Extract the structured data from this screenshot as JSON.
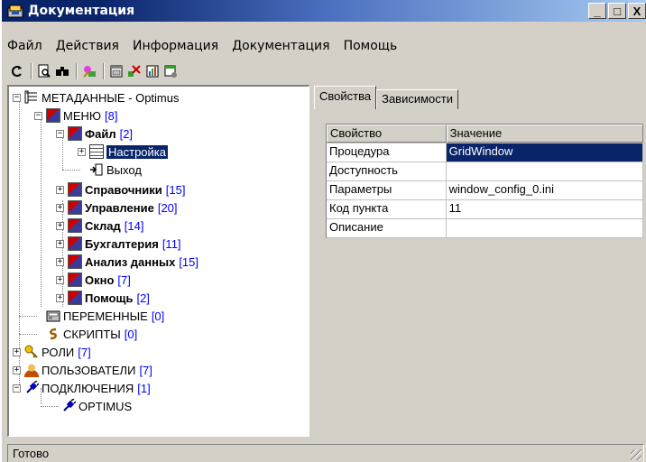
{
  "window": {
    "title": "Документация",
    "minimize": "_",
    "maximize": "□",
    "close": "X"
  },
  "menubar": {
    "items": [
      "Файл",
      "Действия",
      "Информация",
      "Документация",
      "Помощь"
    ]
  },
  "toolbar": {
    "icons": [
      "refresh-icon",
      "preview-icon",
      "find-icon",
      "wizard-icon",
      "calendar-icon",
      "cross-icon",
      "chart-icon",
      "window-icon"
    ]
  },
  "tree": {
    "root": {
      "label": "МЕТАДАННЫЕ - Optimus"
    },
    "menu": {
      "label": "МЕНЮ",
      "count": "[8]"
    },
    "file": {
      "label": "Файл",
      "count": "[2]"
    },
    "settings": {
      "label": "Настройка"
    },
    "exit": {
      "label": "Выход"
    },
    "items": [
      {
        "label": "Справочники",
        "count": "[15]"
      },
      {
        "label": "Управление",
        "count": "[20]"
      },
      {
        "label": "Склад",
        "count": "[14]"
      },
      {
        "label": "Бухгалтерия",
        "count": "[11]"
      },
      {
        "label": "Анализ данных",
        "count": "[15]"
      },
      {
        "label": "Окно",
        "count": "[7]"
      },
      {
        "label": "Помощь",
        "count": "[2]"
      }
    ],
    "variables": {
      "label": "ПЕРЕМЕННЫЕ",
      "count": "[0]"
    },
    "scripts": {
      "label": "СКРИПТЫ",
      "count": "[0]"
    },
    "roles": {
      "label": "РОЛИ",
      "count": "[7]"
    },
    "users": {
      "label": "ПОЛЬЗОВАТЕЛИ",
      "count": "[7]"
    },
    "connections": {
      "label": "ПОДКЛЮЧЕНИЯ",
      "count": "[1]"
    },
    "optimus": {
      "label": "OPTIMUS"
    }
  },
  "tabs": [
    "Свойства",
    "Зависимости"
  ],
  "grid": {
    "headers": [
      "Свойство",
      "Значение"
    ],
    "rows": [
      {
        "property": "Процедура",
        "value": "GridWindow"
      },
      {
        "property": "Доступность",
        "value": ""
      },
      {
        "property": "Параметры",
        "value": "window_config_0.ini"
      },
      {
        "property": "Код пункта",
        "value": "11"
      },
      {
        "property": "Описание",
        "value": ""
      }
    ]
  },
  "status": {
    "text": "Готово"
  },
  "colors": {
    "title_start": "#0a246a",
    "title_end": "#a6caf0",
    "selection": "#0a246a",
    "count_text": "#0000ff",
    "desktop": "#1f1fcf",
    "face": "#d4d0c8"
  }
}
